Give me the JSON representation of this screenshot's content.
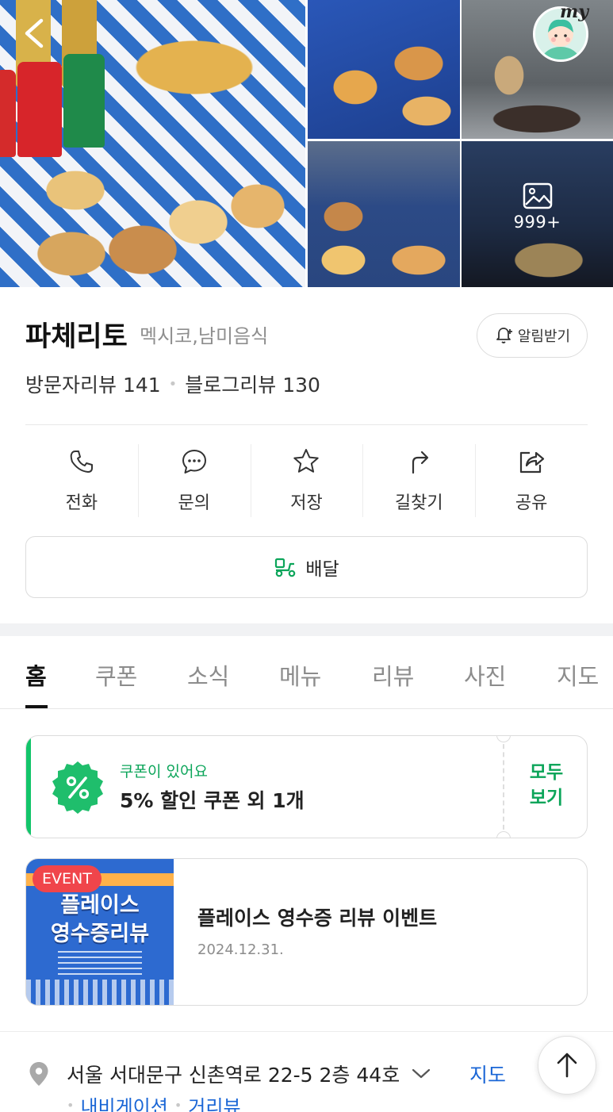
{
  "photos": {
    "more_count": "999+",
    "icons": [
      "back-arrow-icon",
      "image-icon"
    ]
  },
  "my_button": {
    "label": "my"
  },
  "place": {
    "name": "파체리토",
    "category": "멕시코,남미음식",
    "alarm_label": "알림받기",
    "visitor_reviews": "방문자리뷰 141",
    "blog_reviews": "블로그리뷰 130"
  },
  "actions": [
    {
      "label": "전화",
      "icon": "phone-icon"
    },
    {
      "label": "문의",
      "icon": "chat-icon"
    },
    {
      "label": "저장",
      "icon": "star-icon"
    },
    {
      "label": "길찾기",
      "icon": "directions-icon"
    },
    {
      "label": "공유",
      "icon": "share-icon"
    }
  ],
  "delivery": {
    "label": "배달",
    "icon": "delivery-scooter-icon"
  },
  "tabs": [
    "홈",
    "쿠폰",
    "소식",
    "메뉴",
    "리뷰",
    "사진",
    "지도"
  ],
  "coupon": {
    "subtitle": "쿠폰이 있어요",
    "title": "5% 할인 쿠폰 외 1개",
    "view_all_line1": "모두",
    "view_all_line2": "보기",
    "icon": "percent-badge-icon"
  },
  "event": {
    "badge": "EVENT",
    "title": "플레이스 영수증 리뷰 이벤트",
    "date": "2024.12.31.",
    "image_title1": "플레이스",
    "image_title2": "영수증리뷰"
  },
  "address": {
    "text": "서울 서대문구 신촌역로 22-5 2층 44호",
    "map_link": "지도",
    "nav_link": "내비게이션",
    "street_view_link": "거리뷰"
  },
  "colors": {
    "green": "#0ca55a",
    "blue_link": "#1a66d6",
    "event_red": "#f0454b"
  }
}
